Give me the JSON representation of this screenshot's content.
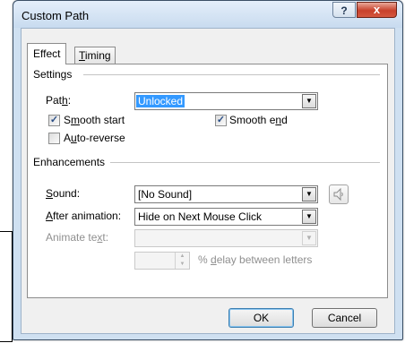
{
  "window": {
    "title": "Custom Path",
    "help_glyph": "?",
    "close_glyph": "x"
  },
  "tabs": [
    {
      "label_pre": "E",
      "label_ul": "",
      "label": "Effect",
      "active": true
    },
    {
      "label": "Timing",
      "ul": "T",
      "active": false
    }
  ],
  "settings": {
    "group_title": "Settings",
    "path_label": "Pat",
    "path_label_ul": "h",
    "path_label_post": ":",
    "path_value": "Unlocked",
    "smooth_start": {
      "pre": "S",
      "ul": "m",
      "post": "ooth start",
      "checked": true
    },
    "smooth_end": {
      "pre": "Smooth e",
      "ul": "n",
      "post": "d",
      "checked": true
    },
    "auto_reverse": {
      "pre": "A",
      "ul": "u",
      "post": "to-reverse",
      "checked": false
    }
  },
  "enhancements": {
    "group_title": "Enhancements",
    "sound_label_ul": "S",
    "sound_label_post": "ound:",
    "sound_value": "[No Sound]",
    "after_label_ul": "A",
    "after_label_post": "fter animation:",
    "after_value": "Hide on Next Mouse Click",
    "animate_label_pre": "Animate te",
    "animate_label_ul": "x",
    "animate_label_post": "t:",
    "animate_value": "",
    "delay_value": "",
    "delay_label_pre": "% ",
    "delay_label_ul": "d",
    "delay_label_post": "elay between letters"
  },
  "buttons": {
    "ok": "OK",
    "cancel": "Cancel"
  },
  "icons": {
    "combo_arrow": "▼",
    "check": "✓",
    "speaker": "speaker-icon"
  }
}
